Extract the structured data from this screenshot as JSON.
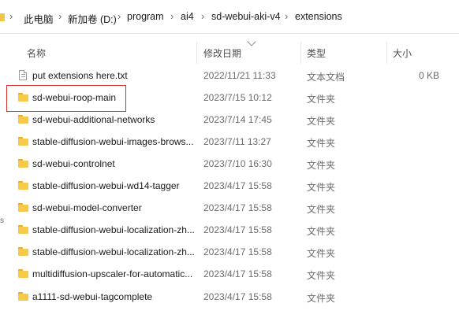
{
  "breadcrumb": {
    "items": [
      "此电脑",
      "新加卷 (D:)",
      "program",
      "ai4",
      "sd-webui-aki-v4",
      "extensions"
    ],
    "separator": "›"
  },
  "columns": {
    "name": "名称",
    "date": "修改日期",
    "type": "类型",
    "size": "大小"
  },
  "files": [
    {
      "name": "put extensions here.txt",
      "date": "2022/11/21 11:33",
      "type": "文本文档",
      "size": "0 KB",
      "icon": "text-file-icon"
    },
    {
      "name": "sd-webui-roop-main",
      "date": "2023/7/15 10:12",
      "type": "文件夹",
      "size": "",
      "icon": "folder-icon"
    },
    {
      "name": "sd-webui-additional-networks",
      "date": "2023/7/14 17:45",
      "type": "文件夹",
      "size": "",
      "icon": "folder-icon"
    },
    {
      "name": "stable-diffusion-webui-images-brows...",
      "date": "2023/7/11 13:27",
      "type": "文件夹",
      "size": "",
      "icon": "folder-icon"
    },
    {
      "name": "sd-webui-controlnet",
      "date": "2023/7/10 16:30",
      "type": "文件夹",
      "size": "",
      "icon": "folder-icon"
    },
    {
      "name": "stable-diffusion-webui-wd14-tagger",
      "date": "2023/4/17 15:58",
      "type": "文件夹",
      "size": "",
      "icon": "folder-icon"
    },
    {
      "name": "sd-webui-model-converter",
      "date": "2023/4/17 15:58",
      "type": "文件夹",
      "size": "",
      "icon": "folder-icon"
    },
    {
      "name": "stable-diffusion-webui-localization-zh...",
      "date": "2023/4/17 15:58",
      "type": "文件夹",
      "size": "",
      "icon": "folder-icon"
    },
    {
      "name": "stable-diffusion-webui-localization-zh...",
      "date": "2023/4/17 15:58",
      "type": "文件夹",
      "size": "",
      "icon": "folder-icon"
    },
    {
      "name": "multidiffusion-upscaler-for-automatic...",
      "date": "2023/4/17 15:58",
      "type": "文件夹",
      "size": "",
      "icon": "folder-icon"
    },
    {
      "name": "a1111-sd-webui-tagcomplete",
      "date": "2023/4/17 15:58",
      "type": "文件夹",
      "size": "",
      "icon": "folder-icon"
    }
  ],
  "side_mark": "s",
  "colors": {
    "folder": "#f7c948",
    "highlight": "#d62d2d"
  }
}
